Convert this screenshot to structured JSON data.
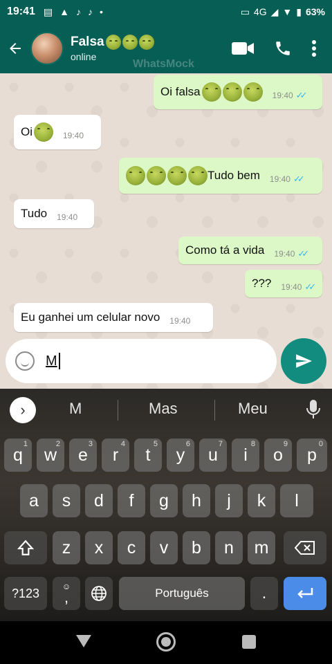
{
  "status_bar": {
    "time": "19:41",
    "left_icons": [
      "newspaper-icon",
      "alert-icon",
      "tiktok-icon",
      "tiktok-icon",
      "dot-icon"
    ],
    "battery": "63%",
    "network": "4G"
  },
  "header": {
    "contact_name": "Falsa",
    "contact_status": "online",
    "watermark": "WhatsMock"
  },
  "messages": [
    {
      "direction": "out",
      "text": "Oi falsa",
      "emoji_count": 3,
      "emoji_position": "after",
      "time": "19:40",
      "read": true
    },
    {
      "direction": "in",
      "text": "Oi",
      "emoji_count": 1,
      "emoji_position": "after",
      "time": "19:40"
    },
    {
      "direction": "out",
      "text": "Tudo bem",
      "emoji_count": 4,
      "emoji_position": "before",
      "time": "19:40",
      "read": true
    },
    {
      "direction": "in",
      "text": "Tudo",
      "emoji_count": 0,
      "time": "19:40"
    },
    {
      "direction": "out",
      "text": "Como tá a vida",
      "emoji_count": 0,
      "time": "19:40",
      "read": true
    },
    {
      "direction": "out",
      "text": "???",
      "emoji_count": 0,
      "time": "19:40",
      "read": true
    },
    {
      "direction": "in",
      "text": "Eu ganhei um celular novo",
      "emoji_count": 0,
      "time": "19:40"
    }
  ],
  "composer": {
    "input_value": "M"
  },
  "keyboard": {
    "suggestions": [
      "M",
      "Mas",
      "Meu"
    ],
    "row1": [
      {
        "k": "q",
        "n": "1"
      },
      {
        "k": "w",
        "n": "2"
      },
      {
        "k": "e",
        "n": "3"
      },
      {
        "k": "r",
        "n": "4"
      },
      {
        "k": "t",
        "n": "5"
      },
      {
        "k": "y",
        "n": "6"
      },
      {
        "k": "u",
        "n": "7"
      },
      {
        "k": "i",
        "n": "8"
      },
      {
        "k": "o",
        "n": "9"
      },
      {
        "k": "p",
        "n": "0"
      }
    ],
    "row2": [
      "a",
      "s",
      "d",
      "f",
      "g",
      "h",
      "j",
      "k",
      "l"
    ],
    "row3": [
      "z",
      "x",
      "c",
      "v",
      "b",
      "n",
      "m"
    ],
    "symbols_label": "?123",
    "comma_label": ",",
    "space_label": "Português",
    "period_label": "."
  },
  "colors": {
    "header": "#075e54",
    "outgoing_bubble": "#dcf8c6",
    "incoming_bubble": "#ffffff",
    "read_ticks": "#34b7f1",
    "send_button": "#128c7e",
    "enter_key": "#4a8ce8"
  }
}
